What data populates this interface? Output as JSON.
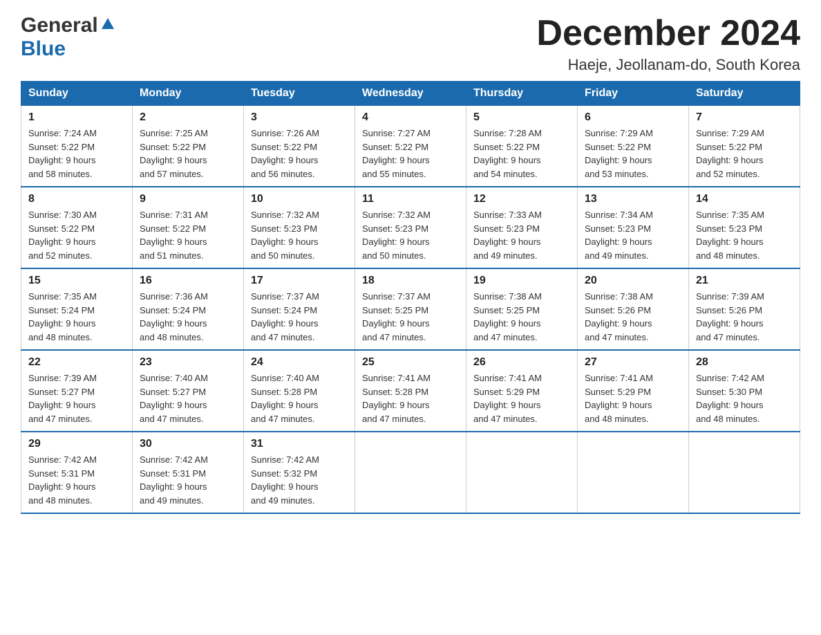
{
  "logo": {
    "general": "General",
    "blue": "Blue"
  },
  "title": "December 2024",
  "subtitle": "Haeje, Jeollanam-do, South Korea",
  "days": [
    "Sunday",
    "Monday",
    "Tuesday",
    "Wednesday",
    "Thursday",
    "Friday",
    "Saturday"
  ],
  "weeks": [
    [
      {
        "day": 1,
        "sunrise": "7:24 AM",
        "sunset": "5:22 PM",
        "daylight": "9 hours and 58 minutes."
      },
      {
        "day": 2,
        "sunrise": "7:25 AM",
        "sunset": "5:22 PM",
        "daylight": "9 hours and 57 minutes."
      },
      {
        "day": 3,
        "sunrise": "7:26 AM",
        "sunset": "5:22 PM",
        "daylight": "9 hours and 56 minutes."
      },
      {
        "day": 4,
        "sunrise": "7:27 AM",
        "sunset": "5:22 PM",
        "daylight": "9 hours and 55 minutes."
      },
      {
        "day": 5,
        "sunrise": "7:28 AM",
        "sunset": "5:22 PM",
        "daylight": "9 hours and 54 minutes."
      },
      {
        "day": 6,
        "sunrise": "7:29 AM",
        "sunset": "5:22 PM",
        "daylight": "9 hours and 53 minutes."
      },
      {
        "day": 7,
        "sunrise": "7:29 AM",
        "sunset": "5:22 PM",
        "daylight": "9 hours and 52 minutes."
      }
    ],
    [
      {
        "day": 8,
        "sunrise": "7:30 AM",
        "sunset": "5:22 PM",
        "daylight": "9 hours and 52 minutes."
      },
      {
        "day": 9,
        "sunrise": "7:31 AM",
        "sunset": "5:22 PM",
        "daylight": "9 hours and 51 minutes."
      },
      {
        "day": 10,
        "sunrise": "7:32 AM",
        "sunset": "5:23 PM",
        "daylight": "9 hours and 50 minutes."
      },
      {
        "day": 11,
        "sunrise": "7:32 AM",
        "sunset": "5:23 PM",
        "daylight": "9 hours and 50 minutes."
      },
      {
        "day": 12,
        "sunrise": "7:33 AM",
        "sunset": "5:23 PM",
        "daylight": "9 hours and 49 minutes."
      },
      {
        "day": 13,
        "sunrise": "7:34 AM",
        "sunset": "5:23 PM",
        "daylight": "9 hours and 49 minutes."
      },
      {
        "day": 14,
        "sunrise": "7:35 AM",
        "sunset": "5:23 PM",
        "daylight": "9 hours and 48 minutes."
      }
    ],
    [
      {
        "day": 15,
        "sunrise": "7:35 AM",
        "sunset": "5:24 PM",
        "daylight": "9 hours and 48 minutes."
      },
      {
        "day": 16,
        "sunrise": "7:36 AM",
        "sunset": "5:24 PM",
        "daylight": "9 hours and 48 minutes."
      },
      {
        "day": 17,
        "sunrise": "7:37 AM",
        "sunset": "5:24 PM",
        "daylight": "9 hours and 47 minutes."
      },
      {
        "day": 18,
        "sunrise": "7:37 AM",
        "sunset": "5:25 PM",
        "daylight": "9 hours and 47 minutes."
      },
      {
        "day": 19,
        "sunrise": "7:38 AM",
        "sunset": "5:25 PM",
        "daylight": "9 hours and 47 minutes."
      },
      {
        "day": 20,
        "sunrise": "7:38 AM",
        "sunset": "5:26 PM",
        "daylight": "9 hours and 47 minutes."
      },
      {
        "day": 21,
        "sunrise": "7:39 AM",
        "sunset": "5:26 PM",
        "daylight": "9 hours and 47 minutes."
      }
    ],
    [
      {
        "day": 22,
        "sunrise": "7:39 AM",
        "sunset": "5:27 PM",
        "daylight": "9 hours and 47 minutes."
      },
      {
        "day": 23,
        "sunrise": "7:40 AM",
        "sunset": "5:27 PM",
        "daylight": "9 hours and 47 minutes."
      },
      {
        "day": 24,
        "sunrise": "7:40 AM",
        "sunset": "5:28 PM",
        "daylight": "9 hours and 47 minutes."
      },
      {
        "day": 25,
        "sunrise": "7:41 AM",
        "sunset": "5:28 PM",
        "daylight": "9 hours and 47 minutes."
      },
      {
        "day": 26,
        "sunrise": "7:41 AM",
        "sunset": "5:29 PM",
        "daylight": "9 hours and 47 minutes."
      },
      {
        "day": 27,
        "sunrise": "7:41 AM",
        "sunset": "5:29 PM",
        "daylight": "9 hours and 48 minutes."
      },
      {
        "day": 28,
        "sunrise": "7:42 AM",
        "sunset": "5:30 PM",
        "daylight": "9 hours and 48 minutes."
      }
    ],
    [
      {
        "day": 29,
        "sunrise": "7:42 AM",
        "sunset": "5:31 PM",
        "daylight": "9 hours and 48 minutes."
      },
      {
        "day": 30,
        "sunrise": "7:42 AM",
        "sunset": "5:31 PM",
        "daylight": "9 hours and 49 minutes."
      },
      {
        "day": 31,
        "sunrise": "7:42 AM",
        "sunset": "5:32 PM",
        "daylight": "9 hours and 49 minutes."
      },
      null,
      null,
      null,
      null
    ]
  ],
  "labels": {
    "sunrise": "Sunrise:",
    "sunset": "Sunset:",
    "daylight": "Daylight:"
  }
}
